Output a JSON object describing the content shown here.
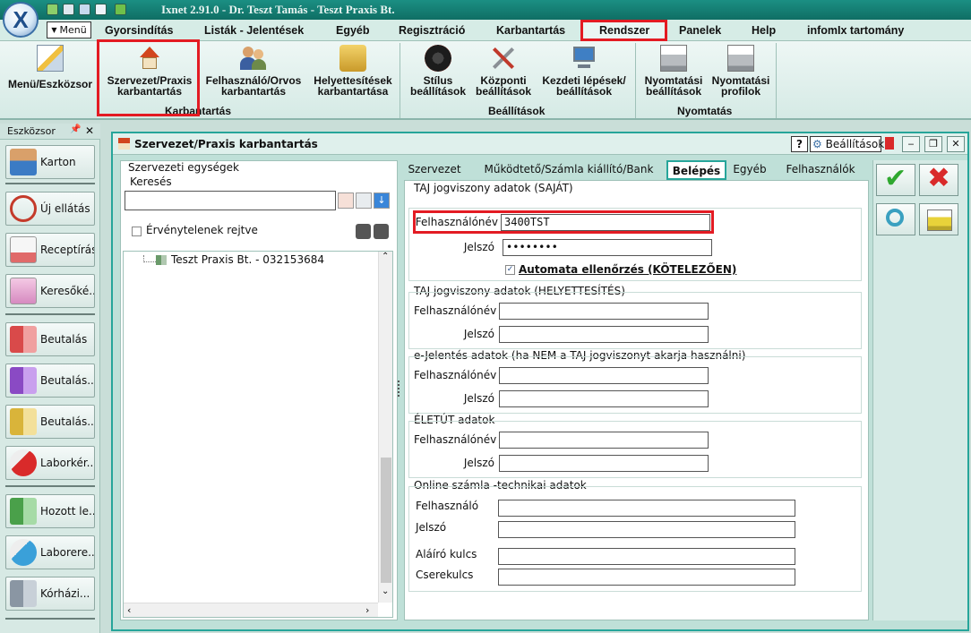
{
  "window": {
    "title": "Ixnet 2.91.0 - Dr. Teszt Tamás - Teszt Praxis Bt.",
    "logo_letter": "X"
  },
  "menu": {
    "menu_button": "Menü",
    "items": [
      {
        "label": "Gyorsindítás"
      },
      {
        "label": "Listák - Jelentések"
      },
      {
        "label": "Egyéb"
      },
      {
        "label": "Regisztráció"
      },
      {
        "label": "Karbantartás"
      },
      {
        "label": "Rendszer"
      },
      {
        "label": "Panelek"
      },
      {
        "label": "Help"
      },
      {
        "label": "infomIx tartomány"
      }
    ]
  },
  "ribbon": {
    "buttons": [
      {
        "line1": "Menü/Eszközsor",
        "line2": ""
      },
      {
        "line1": "Szervezet/Praxis",
        "line2": "karbantartás"
      },
      {
        "line1": "Felhasználó/Orvos",
        "line2": "karbantartás"
      },
      {
        "line1": "Helyettesítések",
        "line2": "karbantartása"
      },
      {
        "line1": "Stílus",
        "line2": "beállítások"
      },
      {
        "line1": "Központi",
        "line2": "beállítások"
      },
      {
        "line1": "Kezdeti lépések/",
        "line2": "beállítások"
      },
      {
        "line1": "Nyomtatási",
        "line2": "beállítások"
      },
      {
        "line1": "Nyomtatási",
        "line2": "profilok"
      }
    ],
    "groups": [
      "Karbantartás",
      "Beállítások",
      "Nyomtatás"
    ]
  },
  "toolbox": {
    "title": "Eszközsor",
    "pin": "📌",
    "close": "✕",
    "items": [
      {
        "label": "Karton"
      },
      {
        "label": "Új ellátás"
      },
      {
        "label": "Receptírás"
      },
      {
        "label": "Keresőké..."
      },
      {
        "label": "Beutalás"
      },
      {
        "label": "Beutalás..."
      },
      {
        "label": "Beutalás..."
      },
      {
        "label": "Laborkér..."
      },
      {
        "label": "Hozott le..."
      },
      {
        "label": "Laborere..."
      },
      {
        "label": "Kórházi..."
      }
    ]
  },
  "doc": {
    "title": "Szervezet/Praxis karbantartás",
    "help": "?",
    "settings": "Beállítások",
    "minimize": "‒",
    "restore": "❐",
    "close": "✕"
  },
  "left_panel": {
    "units_title": "Szervezeti egységek",
    "search_label": "Keresés",
    "search_value": "",
    "hide_invalid_label": "Érvénytelenek rejtve",
    "hide_invalid_checked": false,
    "tree_items": [
      {
        "label": "Teszt Praxis Bt. - 032153684"
      }
    ]
  },
  "tabs": [
    {
      "label": "Szervezet",
      "active": false
    },
    {
      "label": "Működtető/Számla kiállító/Bank",
      "active": false
    },
    {
      "label": "Belépés",
      "active": true
    },
    {
      "label": "Egyéb",
      "active": false
    },
    {
      "label": "Felhasználók",
      "active": false
    }
  ],
  "form": {
    "taj_own": {
      "title": "TAJ jogviszony adatok (SAJÁT)",
      "user_label": "Felhasználónév",
      "user_value": "3400TST",
      "pass_label": "Jelszó",
      "pass_value": "••••••••",
      "auto_check_label": "Automata ellenőrzés (KÖTELEZŐEN)",
      "auto_check_checked": true
    },
    "taj_sub": {
      "title": "TAJ jogviszony adatok (HELYETTESÍTÉS)",
      "user_label": "Felhasználónév",
      "user_value": "",
      "pass_label": "Jelszó",
      "pass_value": ""
    },
    "ejelentes": {
      "title": "e-Jelentés adatok (ha NEM a TAJ jogviszonyt akarja használni)",
      "user_label": "Felhasználónév",
      "user_value": "",
      "pass_label": "Jelszó",
      "pass_value": ""
    },
    "eletut": {
      "title": "ÉLETÚT adatok",
      "user_label": "Felhasználónév",
      "user_value": "",
      "pass_label": "Jelszó",
      "pass_value": ""
    },
    "online": {
      "title": "Online számla -technikai adatok",
      "user_label": "Felhasználó",
      "user_value": "",
      "pass_label": "Jelszó",
      "pass_value": "",
      "sign_label": "Aláíró kulcs",
      "sign_value": "",
      "exchange_label": "Cserekulcs",
      "exchange_value": ""
    }
  },
  "colors": {
    "accent": "#26a59a",
    "highlight": "#e31b23",
    "title_bar": "#0f6e64"
  }
}
